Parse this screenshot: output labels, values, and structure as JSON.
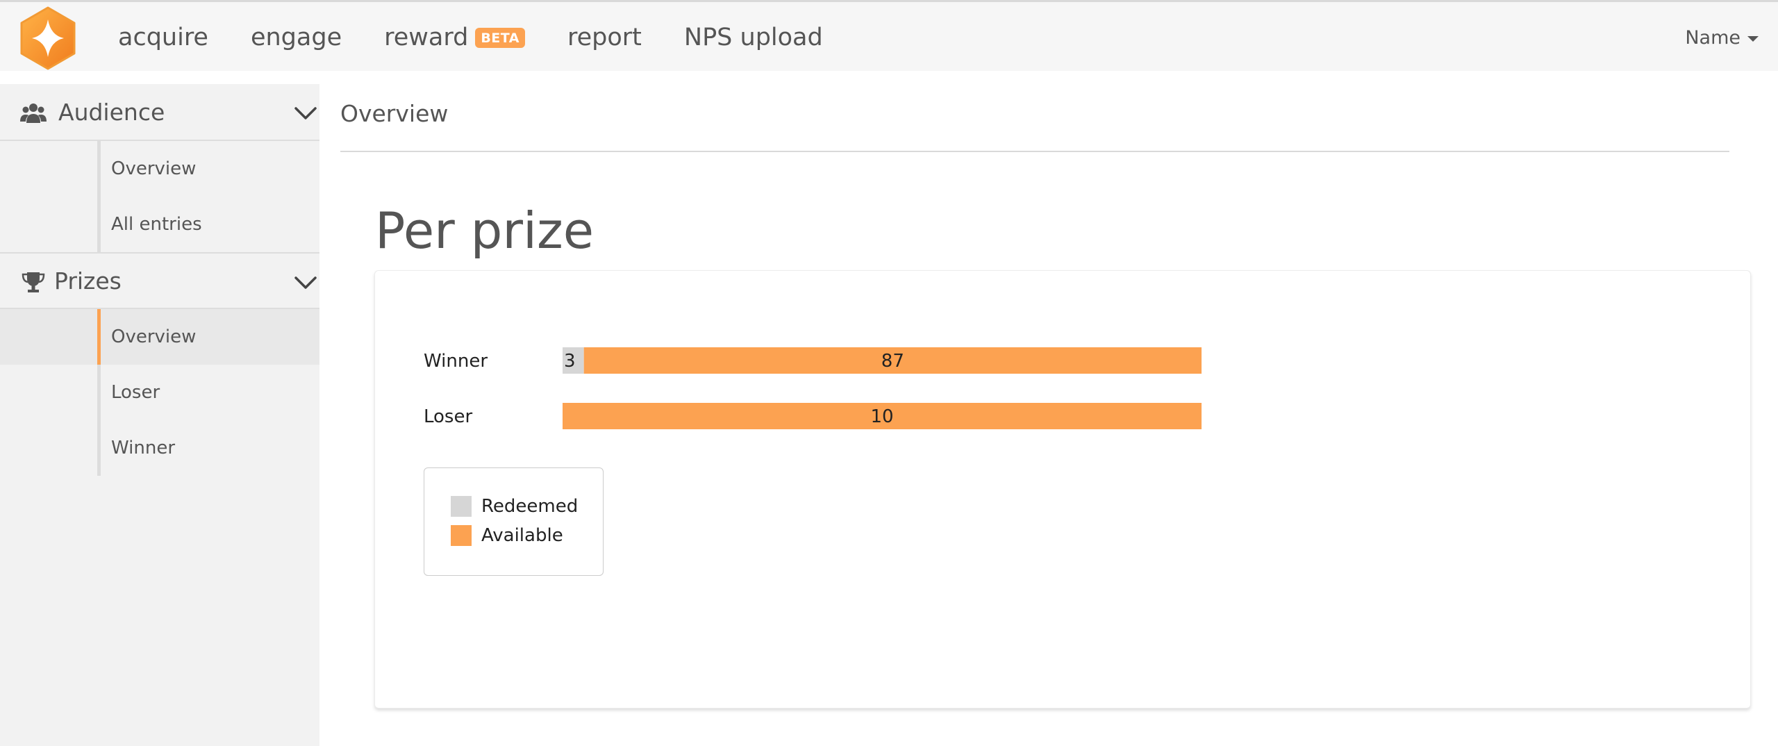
{
  "nav": {
    "items": [
      {
        "label": "acquire"
      },
      {
        "label": "engage"
      },
      {
        "label": "reward",
        "badge": "BETA"
      },
      {
        "label": "report"
      },
      {
        "label": "NPS upload"
      }
    ],
    "user": "Name"
  },
  "sidebar": {
    "audience": {
      "title": "Audience",
      "icon": "users-icon",
      "items": [
        {
          "label": "Overview"
        },
        {
          "label": "All entries"
        }
      ]
    },
    "prizes": {
      "title": "Prizes",
      "icon": "trophy-icon",
      "items": [
        {
          "label": "Overview",
          "active": true
        },
        {
          "label": "Loser"
        },
        {
          "label": "Winner"
        }
      ]
    }
  },
  "main": {
    "title": "Overview",
    "chart_heading": "Per prize"
  },
  "colors": {
    "accent": "#fca251",
    "redeemed": "#d6d6d6",
    "available": "#fca251"
  },
  "chart_data": {
    "type": "bar",
    "orientation": "horizontal",
    "stacked": true,
    "title": "Per prize",
    "categories": [
      "Winner",
      "Loser"
    ],
    "series": [
      {
        "name": "Redeemed",
        "values": [
          3,
          0
        ],
        "color": "#d6d6d6"
      },
      {
        "name": "Available",
        "values": [
          87,
          10
        ],
        "color": "#fca251"
      }
    ],
    "normalized": true,
    "legend": {
      "placement": "bottom-left",
      "entries": [
        "Redeemed",
        "Available"
      ]
    }
  }
}
